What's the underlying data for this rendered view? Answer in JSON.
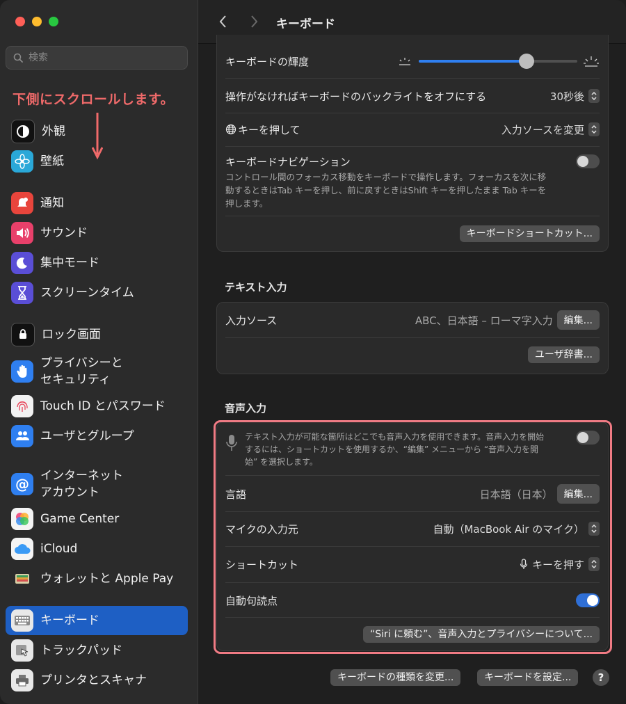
{
  "window": {
    "title": "キーボード"
  },
  "sidebar": {
    "search_placeholder": "検索",
    "annotation": "下側にスクロールします。",
    "items": [
      {
        "label": "外観",
        "icon": "appearance-icon"
      },
      {
        "label": "壁紙",
        "icon": "wallpaper-icon"
      },
      {
        "label": "通知",
        "icon": "notifications-icon"
      },
      {
        "label": "サウンド",
        "icon": "sound-icon"
      },
      {
        "label": "集中モード",
        "icon": "focus-moon-icon"
      },
      {
        "label": "スクリーンタイム",
        "icon": "hourglass-icon"
      },
      {
        "label": "ロック画面",
        "icon": "lock-icon"
      },
      {
        "label": "プライバシーと\nセキュリティ",
        "icon": "hand-icon"
      },
      {
        "label": "Touch ID とパスワード",
        "icon": "fingerprint-icon"
      },
      {
        "label": "ユーザとグループ",
        "icon": "users-icon"
      },
      {
        "label": "インターネット\nアカウント",
        "icon": "at-icon"
      },
      {
        "label": "Game Center",
        "icon": "game-center-icon"
      },
      {
        "label": "iCloud",
        "icon": "cloud-icon"
      },
      {
        "label": "ウォレットと Apple Pay",
        "icon": "wallet-icon"
      },
      {
        "label": "キーボード",
        "icon": "keyboard-icon",
        "selected": true
      },
      {
        "label": "トラックパッド",
        "icon": "trackpad-icon"
      },
      {
        "label": "プリンタとスキャナ",
        "icon": "printer-icon"
      }
    ]
  },
  "keyboard": {
    "brightness_label": "キーボードの輝度",
    "brightness_value": 0.7,
    "backlight_off_label": "操作がなければキーボードのバックライトをオフにする",
    "backlight_off_value": "30秒後",
    "globe_key_label": "キーを押して",
    "globe_key_value": "入力ソースを変更",
    "nav_label": "キーボードナビゲーション",
    "nav_desc": "コントロール間のフォーカス移動をキーボードで操作します。フォーカスを次に移動するときはTab キーを押し、前に戻すときはShift キーを押したまま Tab キーを押します。",
    "nav_enabled": false,
    "shortcuts_button": "キーボードショートカット..."
  },
  "text_input": {
    "section_title": "テキスト入力",
    "input_sources_label": "入力ソース",
    "input_sources_value": "ABC、日本語 – ローマ字入力",
    "edit_button": "編集...",
    "user_dict_button": "ユーザ辞書..."
  },
  "dictation": {
    "section_title": "音声入力",
    "desc": "テキスト入力が可能な箇所はどこでも音声入力を使用できます。音声入力を開始するには、ショートカットを使用するか、“編集” メニューから “音声入力を開始” を選択します。",
    "enabled": false,
    "language_label": "言語",
    "language_value": "日本語（日本）",
    "language_edit_button": "編集...",
    "mic_label": "マイクの入力元",
    "mic_value": "自動（MacBook Air のマイク）",
    "shortcut_label": "ショートカット",
    "shortcut_value": "キーを押す",
    "auto_punct_label": "自動句読点",
    "auto_punct_enabled": true,
    "about_button": "“Siri に頼む”、音声入力とプライバシーについて..."
  },
  "footer": {
    "change_type_button": "キーボードの種類を変更...",
    "setup_button": "キーボードを設定...",
    "help_label": "?"
  }
}
